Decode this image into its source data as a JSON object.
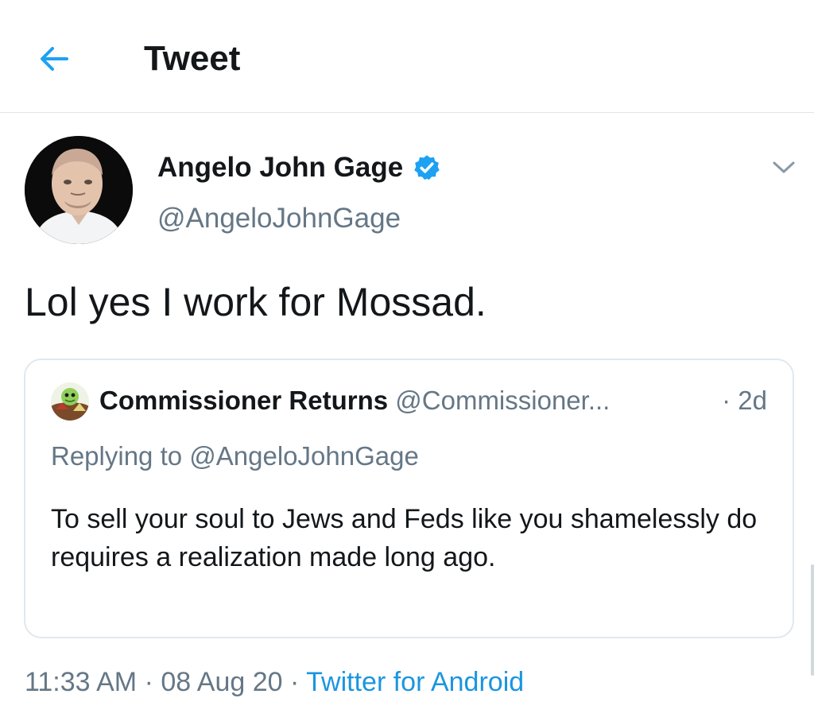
{
  "header": {
    "back_icon": "arrow-left-icon",
    "title": "Tweet",
    "accent_color": "#1da1f2"
  },
  "tweet": {
    "author_name": "Angelo John Gage",
    "author_handle": "@AngeloJohnGage",
    "verified_icon": "verified-badge-icon",
    "menu_icon": "chevron-down-icon",
    "text": "Lol yes I work for Mossad.",
    "time": "11:33 AM",
    "date": "08 Aug 20",
    "separator": "·",
    "source": "Twitter for Android"
  },
  "quote": {
    "author_name": "Commissioner Returns",
    "author_handle": "@Commissioner...",
    "time": "· 2d",
    "replying_to": "Replying to @AngeloJohnGage",
    "text": "To sell your soul to Jews and Feds like you shamelessly do requires a realization made long ago."
  },
  "colors": {
    "text_primary": "#14171a",
    "text_secondary": "#657786",
    "link": "#1b95e0",
    "border": "#e1e8ed"
  }
}
